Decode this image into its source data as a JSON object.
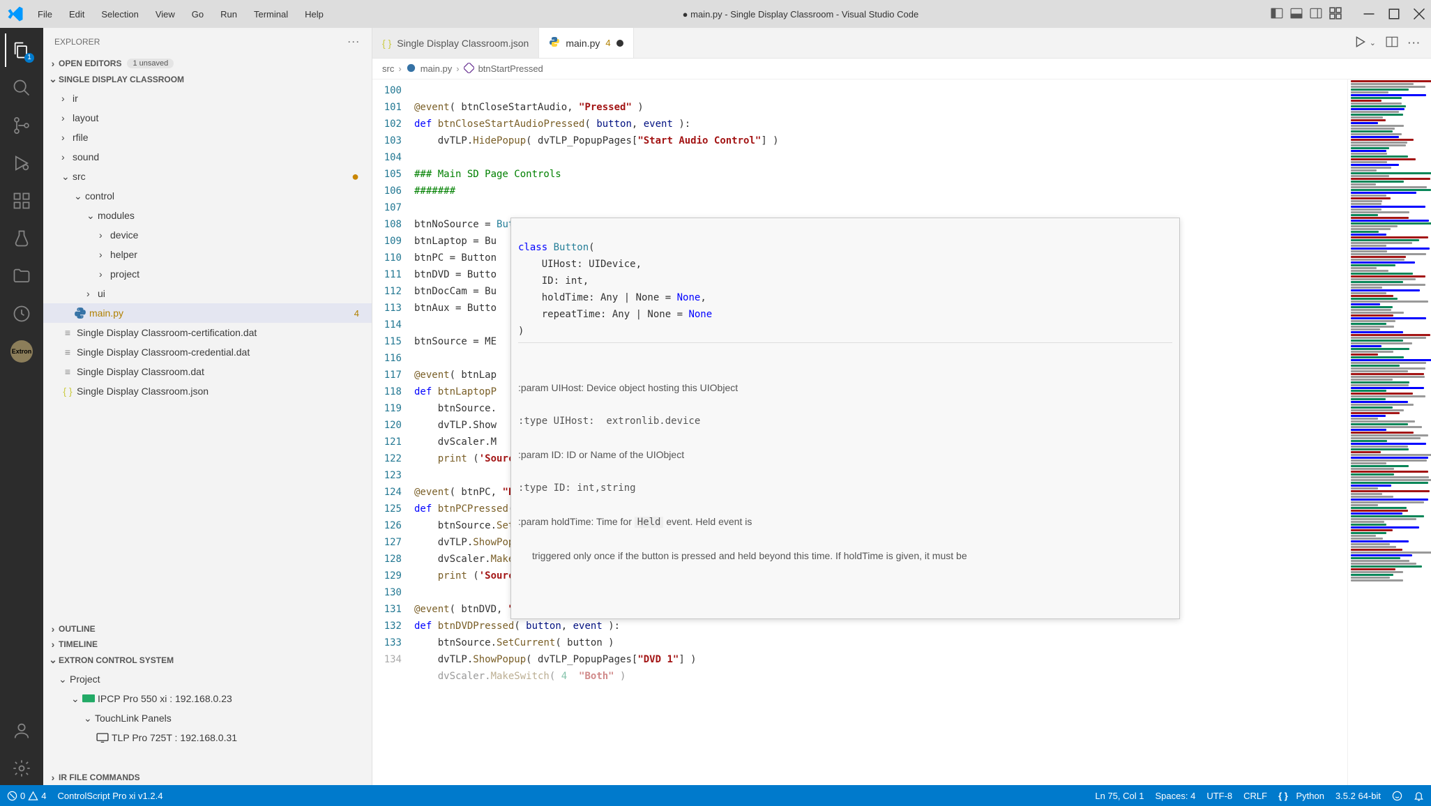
{
  "window": {
    "title": "● main.py - Single Display Classroom - Visual Studio Code"
  },
  "menu": [
    "File",
    "Edit",
    "Selection",
    "View",
    "Go",
    "Run",
    "Terminal",
    "Help"
  ],
  "activitybar": {
    "explorer_badge": "1"
  },
  "sidebar": {
    "title": "EXPLORER",
    "open_editors": {
      "label": "OPEN EDITORS",
      "unsaved": "1 unsaved"
    },
    "folder_name": "SINGLE DISPLAY CLASSROOM",
    "tree": {
      "ir": "ir",
      "layout": "layout",
      "rfile": "rfile",
      "sound": "sound",
      "src": "src",
      "control": "control",
      "modules": "modules",
      "device": "device",
      "helper": "helper",
      "project": "project",
      "ui": "ui",
      "mainpy": "main.py",
      "mainpy_count": "4",
      "cert": "Single Display Classroom-certification.dat",
      "cred": "Single Display Classroom-credential.dat",
      "dat": "Single Display Classroom.dat",
      "json": "Single Display Classroom.json"
    },
    "outline": "OUTLINE",
    "timeline": "TIMELINE",
    "extron": "EXTRON CONTROL SYSTEM",
    "project": "Project",
    "ipcp": "IPCP Pro 550 xi : 192.168.0.23",
    "touchlink": "TouchLink Panels",
    "tlp": "TLP Pro 725T : 192.168.0.31",
    "irfile": "IR FILE COMMANDS"
  },
  "tabs": {
    "t1": "Single Display Classroom.json",
    "t2": "main.py",
    "t2_warn": "4"
  },
  "breadcrumb": {
    "src": "src",
    "main": "main.py",
    "fn": "btnStartPressed"
  },
  "code": {
    "lines": [
      100,
      101,
      102,
      103,
      104,
      105,
      106,
      107,
      108,
      109,
      110,
      111,
      112,
      113,
      114,
      115,
      116,
      117,
      118,
      119,
      120,
      121,
      122,
      123,
      124,
      125,
      126,
      127,
      128,
      129,
      130,
      131,
      132,
      133,
      134
    ],
    "l100": "@event( btnCloseStartAudio, \"Pressed\" )",
    "l101": "def btnCloseStartAudioPressed( button, event ):",
    "l102": "    dvTLP.HidePopup( dvTLP_PopupPages[\"Start Audio Control\"] )",
    "l103": "",
    "l104": "### Main SD Page Controls",
    "l105": "#######",
    "l106": "",
    "l107": "btnNoSource = Button( dvTLP, 20 )",
    "l108": "btnLaptop = Bu",
    "l109": "btnPC = Button",
    "l110": "btnDVD = Butto",
    "l111": "btnDocCam = Bu",
    "l112": "btnAux = Butto",
    "l113": "",
    "l114": "btnSource = ME",
    "l115": "",
    "l116": "@event( btnLap",
    "l117": "def btnLaptopP",
    "l118": "    btnSource.",
    "l119": "    dvTLP.Show",
    "l120": "    dvScaler.M",
    "l121": "    print ('Source - Laptop 1')",
    "l122": "",
    "l123": "@event( btnPC, \"Pressed\" )",
    "l124": "def btnPCPressed( button, event ):",
    "l125": "    btnSource.SetCurrent( button )",
    "l126": "    dvTLP.ShowPopup( dvTLP_PopupPages[\"PC 1\"] )",
    "l127": "    dvScaler.MakeSwitch( 3, \"Both\" )",
    "l128": "    print ('Source - PC 1')",
    "l129": "",
    "l130": "@event( btnDVD, \"Pressed\" )",
    "l131": "def btnDVDPressed( button, event ):",
    "l132": "    btnSource.SetCurrent( button )",
    "l133": "    dvTLP.ShowPopup( dvTLP_PopupPages[\"DVD 1\"] )",
    "l134": "    dvScaler.MakeSwitch( 4  \"Both\" )"
  },
  "hover": {
    "sig_class": "class",
    "sig_name": "Button",
    "p1": "UIHost: UIDevice,",
    "p2": "ID: int,",
    "p3a": "holdTime: Any | None = ",
    "p3b": "None",
    "p4a": "repeatTime: Any | None = ",
    "p4b": "None",
    "d1": ":param UIHost: Device object hosting this UIObject",
    "d2": ":type UIHost:  extronlib.device",
    "d3": ":param ID: ID or Name of the UIObject",
    "d4": ":type ID: int,string",
    "d5a": ":param holdTime: Time for ",
    "d5b": "Held",
    "d5c": " event. Held event is",
    "d6": "triggered only once if the button is pressed and held beyond this time. If holdTime is given, it must be"
  },
  "statusbar": {
    "errors": "0",
    "warnings": "4",
    "cscript": "ControlScript Pro xi v1.2.4",
    "lncol": "Ln 75, Col 1",
    "spaces": "Spaces: 4",
    "enc": "UTF-8",
    "eol": "CRLF",
    "lang": "Python",
    "py": "3.5.2 64-bit"
  }
}
